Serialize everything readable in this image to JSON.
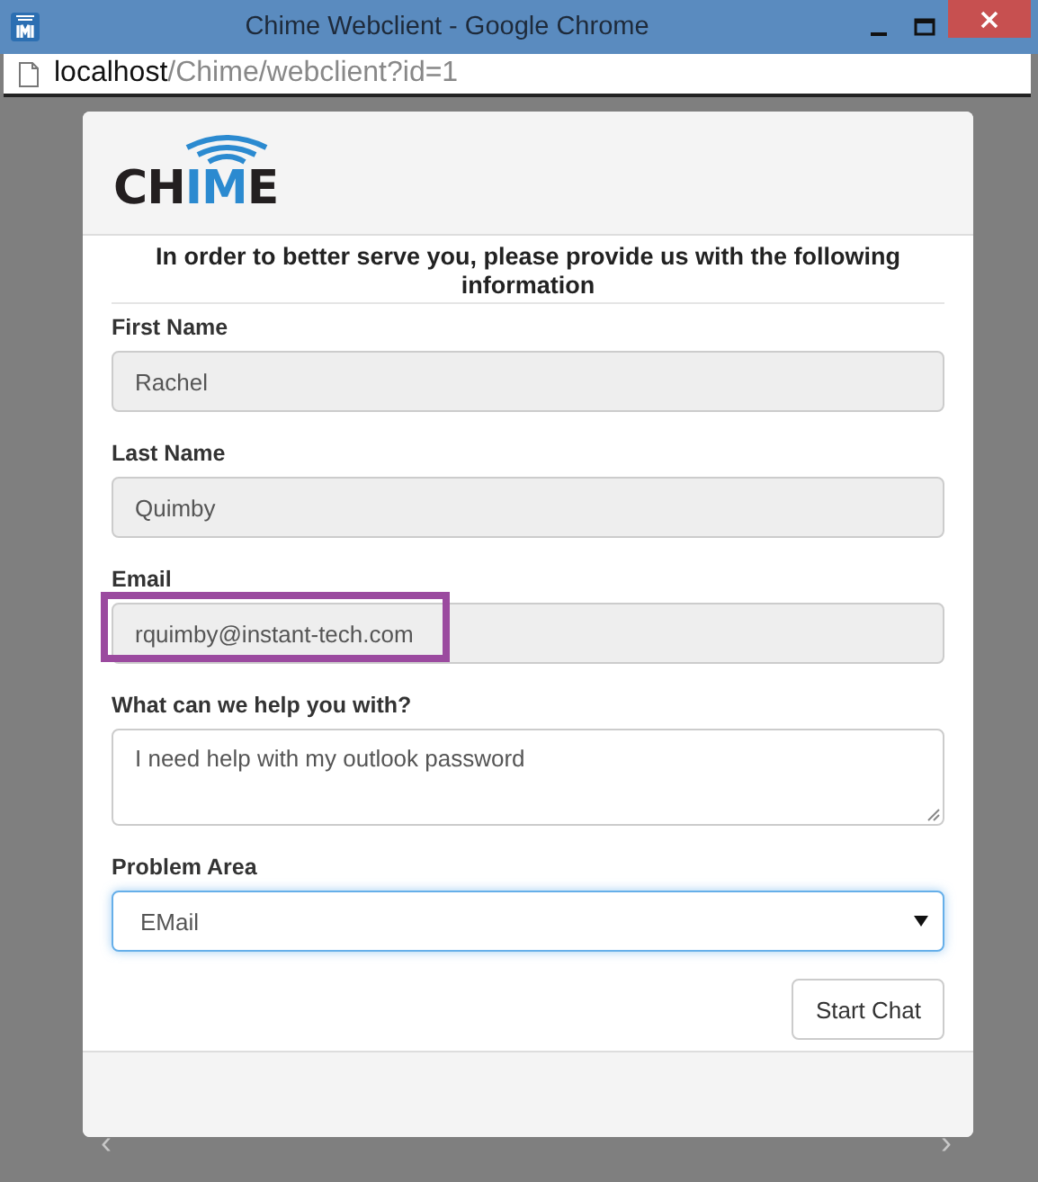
{
  "window": {
    "title": "Chime Webclient - Google Chrome"
  },
  "address_bar": {
    "host": "localhost",
    "path": "/Chime/webclient?id=1"
  },
  "logo": {
    "parts": [
      {
        "text": "CH",
        "color": "#231f20"
      },
      {
        "text": "IM",
        "color": "#2b8ad0"
      },
      {
        "text": "E",
        "color": "#231f20"
      }
    ]
  },
  "form": {
    "heading": "In order to better serve you, please provide us with the following information",
    "fields": [
      {
        "kind": "input",
        "label": "First Name",
        "value": "Rachel",
        "readonly": true
      },
      {
        "kind": "input",
        "label": "Last Name",
        "value": "Quimby",
        "readonly": true
      },
      {
        "kind": "input",
        "label": "Email",
        "value": "rquimby@instant-tech.com",
        "readonly": true,
        "highlighted": true
      },
      {
        "kind": "textarea",
        "label": "What can we help you with?",
        "value": "I need help with my outlook password",
        "readonly": false
      },
      {
        "kind": "select",
        "label": "Problem Area",
        "value": "EMail",
        "readonly": false,
        "focused": true
      }
    ],
    "button": "Start Chat"
  },
  "carousel": {
    "prev": "‹",
    "next": "›"
  }
}
